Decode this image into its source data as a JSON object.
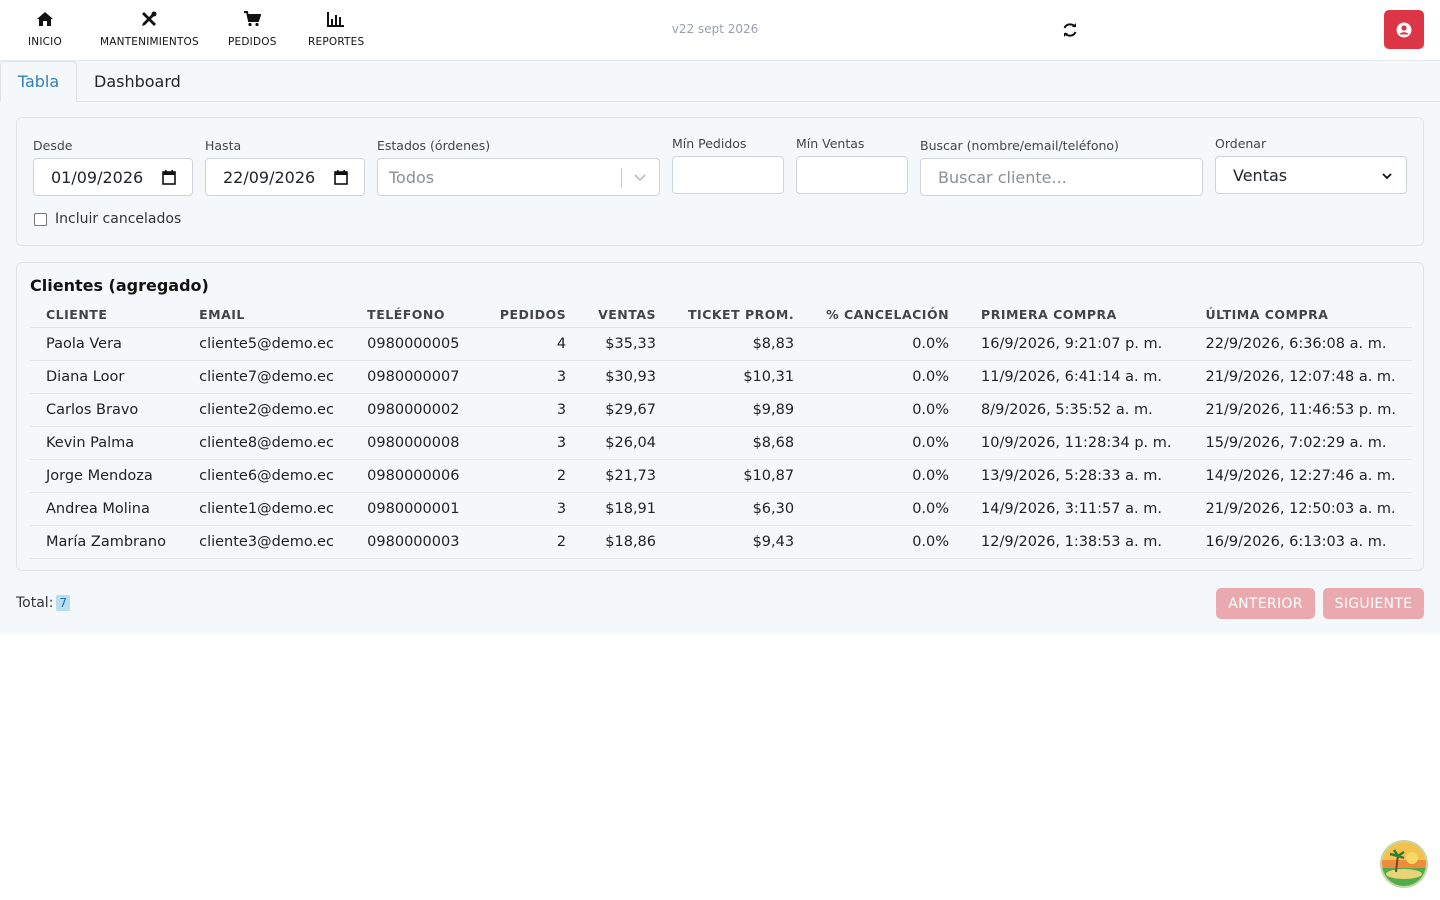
{
  "nav": {
    "items": [
      {
        "label": "INICIO",
        "icon": "home-icon"
      },
      {
        "label": "MANTENIMIENTOS",
        "icon": "tools-icon"
      },
      {
        "label": "PEDIDOS",
        "icon": "cart-icon"
      },
      {
        "label": "REPORTES",
        "icon": "bar-chart-icon"
      }
    ],
    "version": "v22 sept 2026"
  },
  "tabs": {
    "tabla": "Tabla",
    "dashboard": "Dashboard"
  },
  "filters": {
    "desde_label": "Desde",
    "desde_value": "01/09/2026",
    "hasta_label": "Hasta",
    "hasta_value": "22/09/2026",
    "estados_label": "Estados (órdenes)",
    "estados_placeholder": "Todos",
    "min_pedidos_label": "Mín Pedidos",
    "min_ventas_label": "Mín Ventas",
    "buscar_label": "Buscar (nombre/email/teléfono)",
    "buscar_placeholder": "Buscar cliente...",
    "ordenar_label": "Ordenar",
    "ordenar_value": "Ventas",
    "incluir_cancelados": "Incluir cancelados"
  },
  "table": {
    "title": "Clientes (agregado)",
    "headers": [
      "CLIENTE",
      "EMAIL",
      "TELÉFONO",
      "PEDIDOS",
      "VENTAS",
      "TICKET PROM.",
      "% CANCELACIÓN",
      "PRIMERA COMPRA",
      "ÚLTIMA COMPRA"
    ],
    "rows": [
      [
        "Paola Vera",
        "cliente5@demo.ec",
        "0980000005",
        "4",
        "$35,33",
        "$8,83",
        "0.0%",
        "16/9/2026, 9:21:07 p. m.",
        "22/9/2026, 6:36:08 a. m."
      ],
      [
        "Diana Loor",
        "cliente7@demo.ec",
        "0980000007",
        "3",
        "$30,93",
        "$10,31",
        "0.0%",
        "11/9/2026, 6:41:14 a. m.",
        "21/9/2026, 12:07:48 a. m."
      ],
      [
        "Carlos Bravo",
        "cliente2@demo.ec",
        "0980000002",
        "3",
        "$29,67",
        "$9,89",
        "0.0%",
        "8/9/2026, 5:35:52 a. m.",
        "21/9/2026, 11:46:53 p. m."
      ],
      [
        "Kevin Palma",
        "cliente8@demo.ec",
        "0980000008",
        "3",
        "$26,04",
        "$8,68",
        "0.0%",
        "10/9/2026, 11:28:34 p. m.",
        "15/9/2026, 7:02:29 a. m."
      ],
      [
        "Jorge Mendoza",
        "cliente6@demo.ec",
        "0980000006",
        "2",
        "$21,73",
        "$10,87",
        "0.0%",
        "13/9/2026, 5:28:33 a. m.",
        "14/9/2026, 12:27:46 a. m."
      ],
      [
        "Andrea Molina",
        "cliente1@demo.ec",
        "0980000001",
        "3",
        "$18,91",
        "$6,30",
        "0.0%",
        "14/9/2026, 3:11:57 a. m.",
        "21/9/2026, 12:50:03 a. m."
      ],
      [
        "María Zambrano",
        "cliente3@demo.ec",
        "0980000003",
        "2",
        "$18,86",
        "$9,43",
        "0.0%",
        "12/9/2026, 1:38:53 a. m.",
        "16/9/2026, 6:13:03 a. m."
      ]
    ]
  },
  "footer": {
    "total_label": "Total:",
    "total_value": "7",
    "prev": "ANTERIOR",
    "next": "SIGUIENTE"
  },
  "colors": {
    "accent": "#dc3545",
    "tab_active": "#2f7fb8",
    "disabled_btn": "#e9a9ae"
  }
}
